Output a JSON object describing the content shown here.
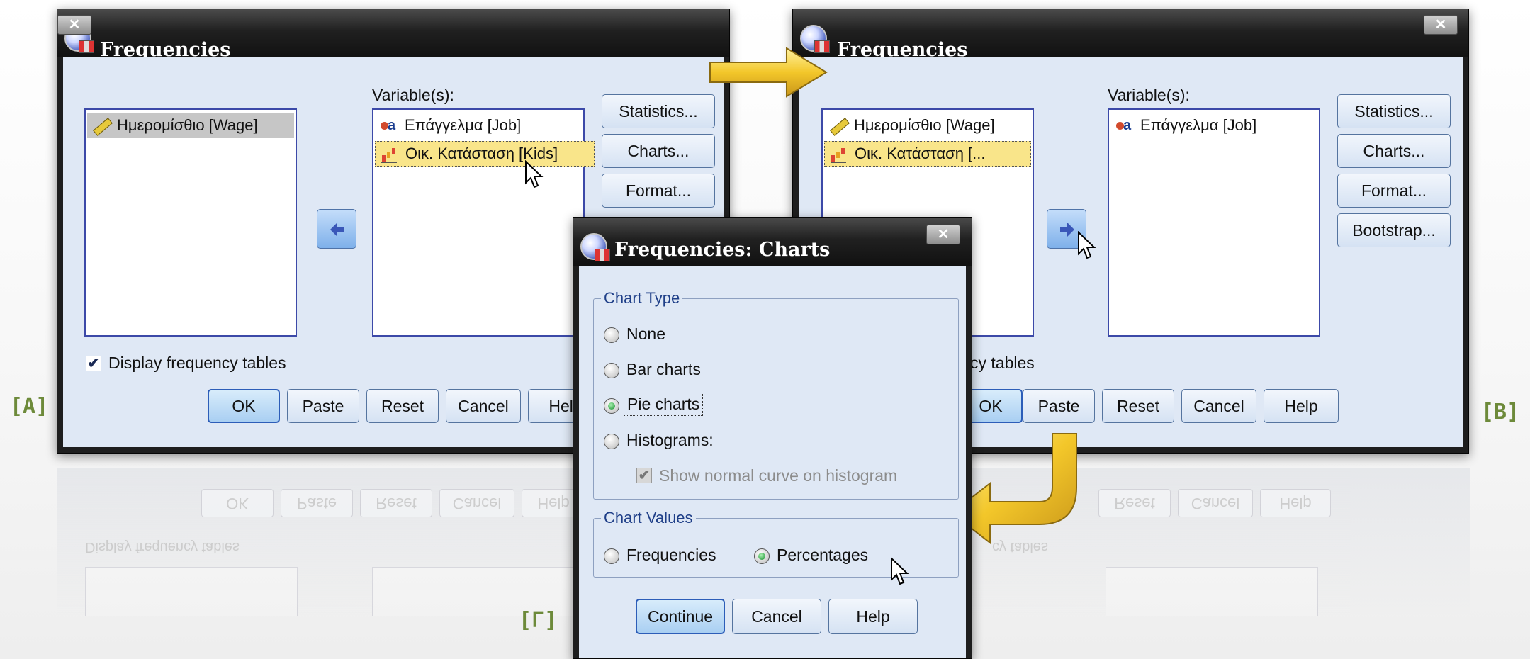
{
  "panel_letters": {
    "a": "[A]",
    "b": "[B]",
    "g": "[Γ]"
  },
  "dialog_a": {
    "title": "Frequencies",
    "source_items": [
      {
        "label": "Ημερομίσθιο [Wage]",
        "icon": "scale-icon"
      }
    ],
    "variables_label": "Variable(s):",
    "target_items": [
      {
        "label": "Επάγγελμα [Job]",
        "icon": "nominal-icon"
      },
      {
        "label": "Οικ. Κατάσταση [Kids]",
        "icon": "ordinal-icon"
      }
    ],
    "side_buttons": [
      "Statistics...",
      "Charts...",
      "Format..."
    ],
    "display_tables_label": "Display frequency tables",
    "display_tables_checked": true,
    "bottom_buttons": [
      "OK",
      "Paste",
      "Reset",
      "Cancel",
      "Help"
    ]
  },
  "dialog_b": {
    "title": "Frequencies",
    "source_items": [
      {
        "label": "Ημερομίσθιο [Wage]",
        "icon": "scale-icon"
      },
      {
        "label": "Οικ. Κατάσταση [...",
        "icon": "ordinal-icon"
      }
    ],
    "variables_label": "Variable(s):",
    "target_items": [
      {
        "label": "Επάγγελμα [Job]",
        "icon": "nominal-icon"
      }
    ],
    "side_buttons": [
      "Statistics...",
      "Charts...",
      "Format...",
      "Bootstrap..."
    ],
    "display_tables_fragment": "cy tables",
    "bottom_buttons": [
      "OK",
      "Paste",
      "Reset",
      "Cancel",
      "Help"
    ]
  },
  "charts_dialog": {
    "title": "Frequencies: Charts",
    "chart_type_label": "Chart Type",
    "chart_types": [
      "None",
      "Bar charts",
      "Pie charts",
      "Histograms:"
    ],
    "selected_chart_type": "Pie charts",
    "normal_curve_label": "Show normal curve on histogram",
    "chart_values_label": "Chart Values",
    "chart_values": [
      "Frequencies",
      "Percentages"
    ],
    "selected_chart_value": "Percentages",
    "buttons": [
      "Continue",
      "Cancel",
      "Help"
    ]
  },
  "reflection": {
    "buttons": [
      "OK",
      "Paste",
      "Reset",
      "Cancel",
      "Help"
    ],
    "text": "Display frequency tables",
    "text_b": "cy tables"
  },
  "colors": {
    "dialog_bg": "#dfe8f5",
    "titlebar": "#1e1e1e",
    "flow_arrow": "#f3c72a",
    "letter": "#6d8a3a"
  }
}
